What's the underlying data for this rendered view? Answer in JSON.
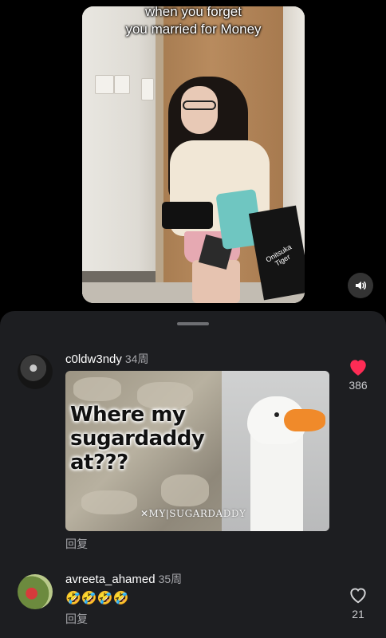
{
  "video": {
    "caption_line1": "when you forget",
    "caption_line2": "you married for Money",
    "bag_label": "Onitsuka Tiger",
    "mute_icon": "speaker-icon"
  },
  "comments": [
    {
      "username": "c0ldw3ndy",
      "time": "34周",
      "meme": {
        "text": "Where my sugardaddy at???",
        "watermark": "✕MY|SUGARDADDY"
      },
      "reply_label": "回复",
      "like_count": "386",
      "liked": true,
      "like_color": "#fe2c55"
    },
    {
      "username": "avreeta_ahamed",
      "time": "35周",
      "text": "🤣🤣🤣🤣",
      "reply_label": "回复",
      "like_count": "21",
      "liked": false
    }
  ]
}
